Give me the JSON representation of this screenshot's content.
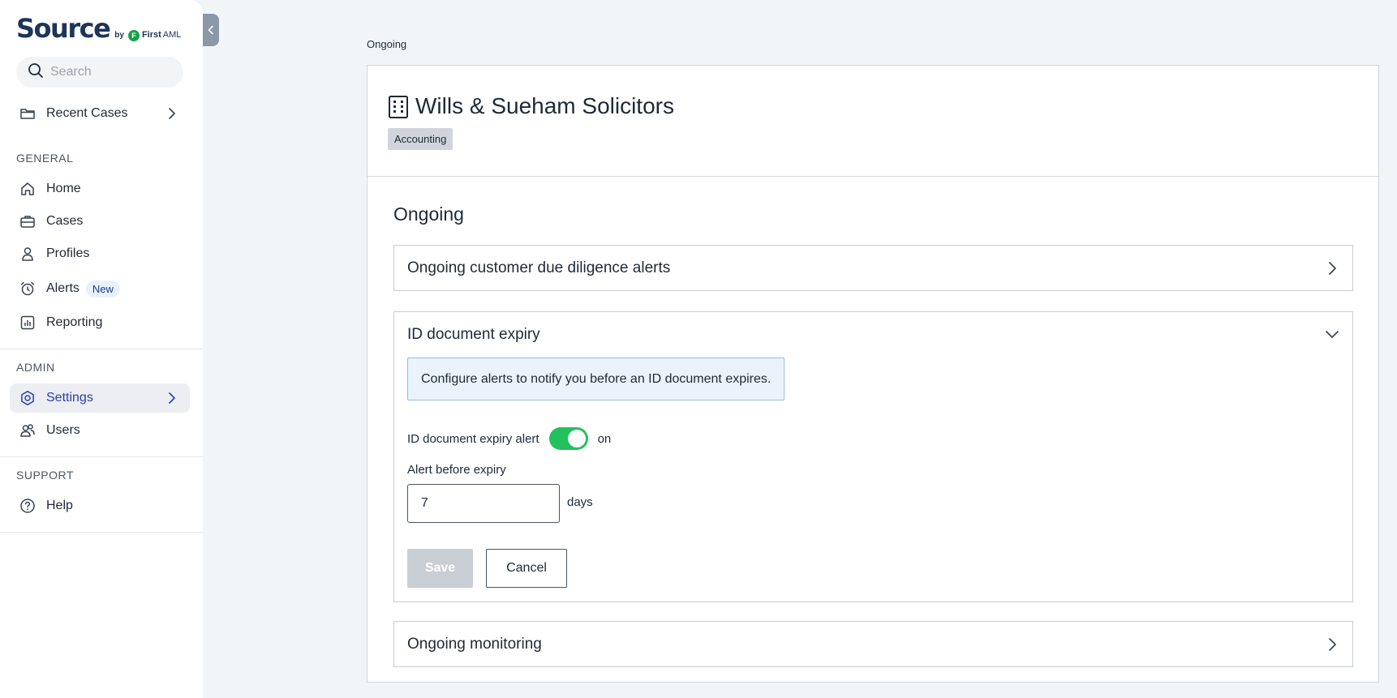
{
  "brand": {
    "name": "Source",
    "by": "by",
    "partner_first": "First",
    "partner_second": "AML"
  },
  "search": {
    "placeholder": "Search"
  },
  "sidebar": {
    "recent": {
      "label": "Recent Cases",
      "icon": "folder-icon"
    },
    "general_label": "GENERAL",
    "general": [
      {
        "label": "Home",
        "icon": "home-icon"
      },
      {
        "label": "Cases",
        "icon": "briefcase-icon"
      },
      {
        "label": "Profiles",
        "icon": "person-icon"
      },
      {
        "label": "Alerts",
        "icon": "alarm-clock-icon",
        "badge": "New"
      },
      {
        "label": "Reporting",
        "icon": "report-chart-icon"
      }
    ],
    "admin_label": "ADMIN",
    "admin": [
      {
        "label": "Settings",
        "icon": "gear-icon",
        "active": true
      },
      {
        "label": "Users",
        "icon": "users-icon"
      }
    ],
    "support_label": "SUPPORT",
    "support": [
      {
        "label": "Help",
        "icon": "help-circle-icon"
      }
    ]
  },
  "main": {
    "breadcrumb": "Ongoing",
    "org": {
      "name": "Wills & Sueham Solicitors",
      "tag": "Accounting"
    },
    "section_title": "Ongoing",
    "accordions": {
      "cdd": {
        "title": "Ongoing customer due diligence alerts",
        "expanded": false
      },
      "id_expiry": {
        "title": "ID document expiry",
        "expanded": true,
        "info": "Configure alerts to notify you before an ID document expires.",
        "toggle_label": "ID document expiry alert",
        "toggle_state": "on",
        "field_label": "Alert before expiry",
        "field_value": "7",
        "unit": "days",
        "save_label": "Save",
        "cancel_label": "Cancel"
      },
      "monitoring": {
        "title": "Ongoing monitoring",
        "expanded": false
      }
    }
  },
  "colors": {
    "toggle_on": "#21c25e",
    "active_nav": "#2b3bb5",
    "brand_navy": "#1d3557",
    "info_bg": "#eaf3fc"
  }
}
